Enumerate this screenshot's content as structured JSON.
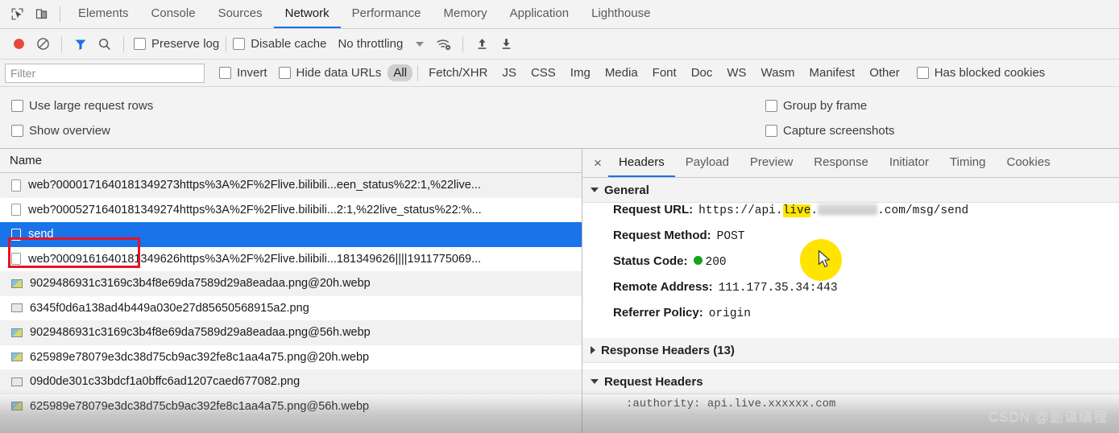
{
  "devtools": {
    "left_icons": [
      {
        "name": "inspect-element-icon",
        "glyph": "inspect"
      },
      {
        "name": "device-toolbar-icon",
        "glyph": "device"
      }
    ],
    "panel_tabs": [
      {
        "label": "Elements",
        "active": false
      },
      {
        "label": "Console",
        "active": false
      },
      {
        "label": "Sources",
        "active": false
      },
      {
        "label": "Network",
        "active": true
      },
      {
        "label": "Performance",
        "active": false
      },
      {
        "label": "Memory",
        "active": false
      },
      {
        "label": "Application",
        "active": false
      },
      {
        "label": "Lighthouse",
        "active": false
      }
    ]
  },
  "network_toolbar": {
    "record_icon": "record-icon",
    "clear_icon": "clear-icon",
    "filter_icon": "filter-funnel-icon",
    "search_icon": "search-icon",
    "preserve_log_label": "Preserve log",
    "disable_cache_label": "Disable cache",
    "throttling_label": "No throttling",
    "network_conditions_icon": "wifi-settings-icon",
    "import_har_icon": "import-arrow-up-icon",
    "export_har_icon": "export-arrow-down-icon",
    "accent_color": "#1a73e8",
    "record_color": "#e8483c"
  },
  "filter_bar": {
    "filter_placeholder": "Filter",
    "filter_value": "",
    "invert_label": "Invert",
    "hide_data_urls_label": "Hide data URLs",
    "types": [
      {
        "label": "All",
        "selected": true
      },
      {
        "label": "Fetch/XHR",
        "selected": false
      },
      {
        "label": "JS",
        "selected": false
      },
      {
        "label": "CSS",
        "selected": false
      },
      {
        "label": "Img",
        "selected": false
      },
      {
        "label": "Media",
        "selected": false
      },
      {
        "label": "Font",
        "selected": false
      },
      {
        "label": "Doc",
        "selected": false
      },
      {
        "label": "WS",
        "selected": false
      },
      {
        "label": "Wasm",
        "selected": false
      },
      {
        "label": "Manifest",
        "selected": false
      },
      {
        "label": "Other",
        "selected": false
      }
    ],
    "has_blocked_cookies_label": "Has blocked cookies"
  },
  "settings": {
    "use_large_request_rows_label": "Use large request rows",
    "show_overview_label": "Show overview",
    "group_by_frame_label": "Group by frame",
    "capture_screenshots_label": "Capture screenshots"
  },
  "requests": {
    "column_header": "Name",
    "rows": [
      {
        "name": "web?0000171640181349273https%3A%2F%2Flive.bilibili...een_status%22:1,%22live...",
        "icon": "document-icon",
        "selected": false
      },
      {
        "name": "web?0005271640181349274https%3A%2F%2Flive.bilibili...2:1,%22live_status%22:%...",
        "icon": "document-icon",
        "selected": false
      },
      {
        "name": "send",
        "icon": "document-icon",
        "selected": true
      },
      {
        "name": "web?0009161640181349626https%3A%2F%2Flive.bilibili...181349626||||1911775069...",
        "icon": "document-icon",
        "selected": false
      },
      {
        "name": "9029486931c3169c3b4f8e69da7589d29a8eadaa.png@20h.webp",
        "icon": "image-icon",
        "selected": false
      },
      {
        "name": "6345f0d6a138ad4b449a030e27d85650568915a2.png",
        "icon": "image-plain-icon",
        "selected": false
      },
      {
        "name": "9029486931c3169c3b4f8e69da7589d29a8eadaa.png@56h.webp",
        "icon": "image-icon",
        "selected": false
      },
      {
        "name": "625989e78079e3dc38d75cb9ac392fe8c1aa4a75.png@20h.webp",
        "icon": "image-icon",
        "selected": false
      },
      {
        "name": "09d0de301c33bdcf1a0bffc6ad1207caed677082.png",
        "icon": "image-plain-icon",
        "selected": false
      },
      {
        "name": "625989e78079e3dc38d75cb9ac392fe8c1aa4a75.png@56h.webp",
        "icon": "image-icon",
        "selected": false
      }
    ]
  },
  "details": {
    "close_label": "×",
    "tabs": [
      {
        "label": "Headers",
        "active": true
      },
      {
        "label": "Payload",
        "active": false
      },
      {
        "label": "Preview",
        "active": false
      },
      {
        "label": "Response",
        "active": false
      },
      {
        "label": "Initiator",
        "active": false
      },
      {
        "label": "Timing",
        "active": false
      },
      {
        "label": "Cookies",
        "active": false
      }
    ],
    "general_section_label": "General",
    "general": [
      {
        "key": "Request URL:",
        "value_prefix": "https://api.",
        "value_highlight": "live",
        "value_suffix": ".com/msg/send",
        "redacted": true
      },
      {
        "key": "Request Method:",
        "value": "POST"
      },
      {
        "key": "Status Code:",
        "value": "200",
        "status_dot": "#18a318"
      },
      {
        "key": "Remote Address:",
        "value": "111.177.35.34:443"
      },
      {
        "key": "Referrer Policy:",
        "value": "origin"
      }
    ],
    "response_headers_label": "Response Headers (13)",
    "request_headers_label": "Request Headers",
    "partial_header": ":authority: api.live.xxxxxx.com"
  },
  "overlay": {
    "watermark": "CSDN @删谋编程",
    "annotation_color": "#e81123",
    "cursor_highlight_color": "#ffe400"
  }
}
